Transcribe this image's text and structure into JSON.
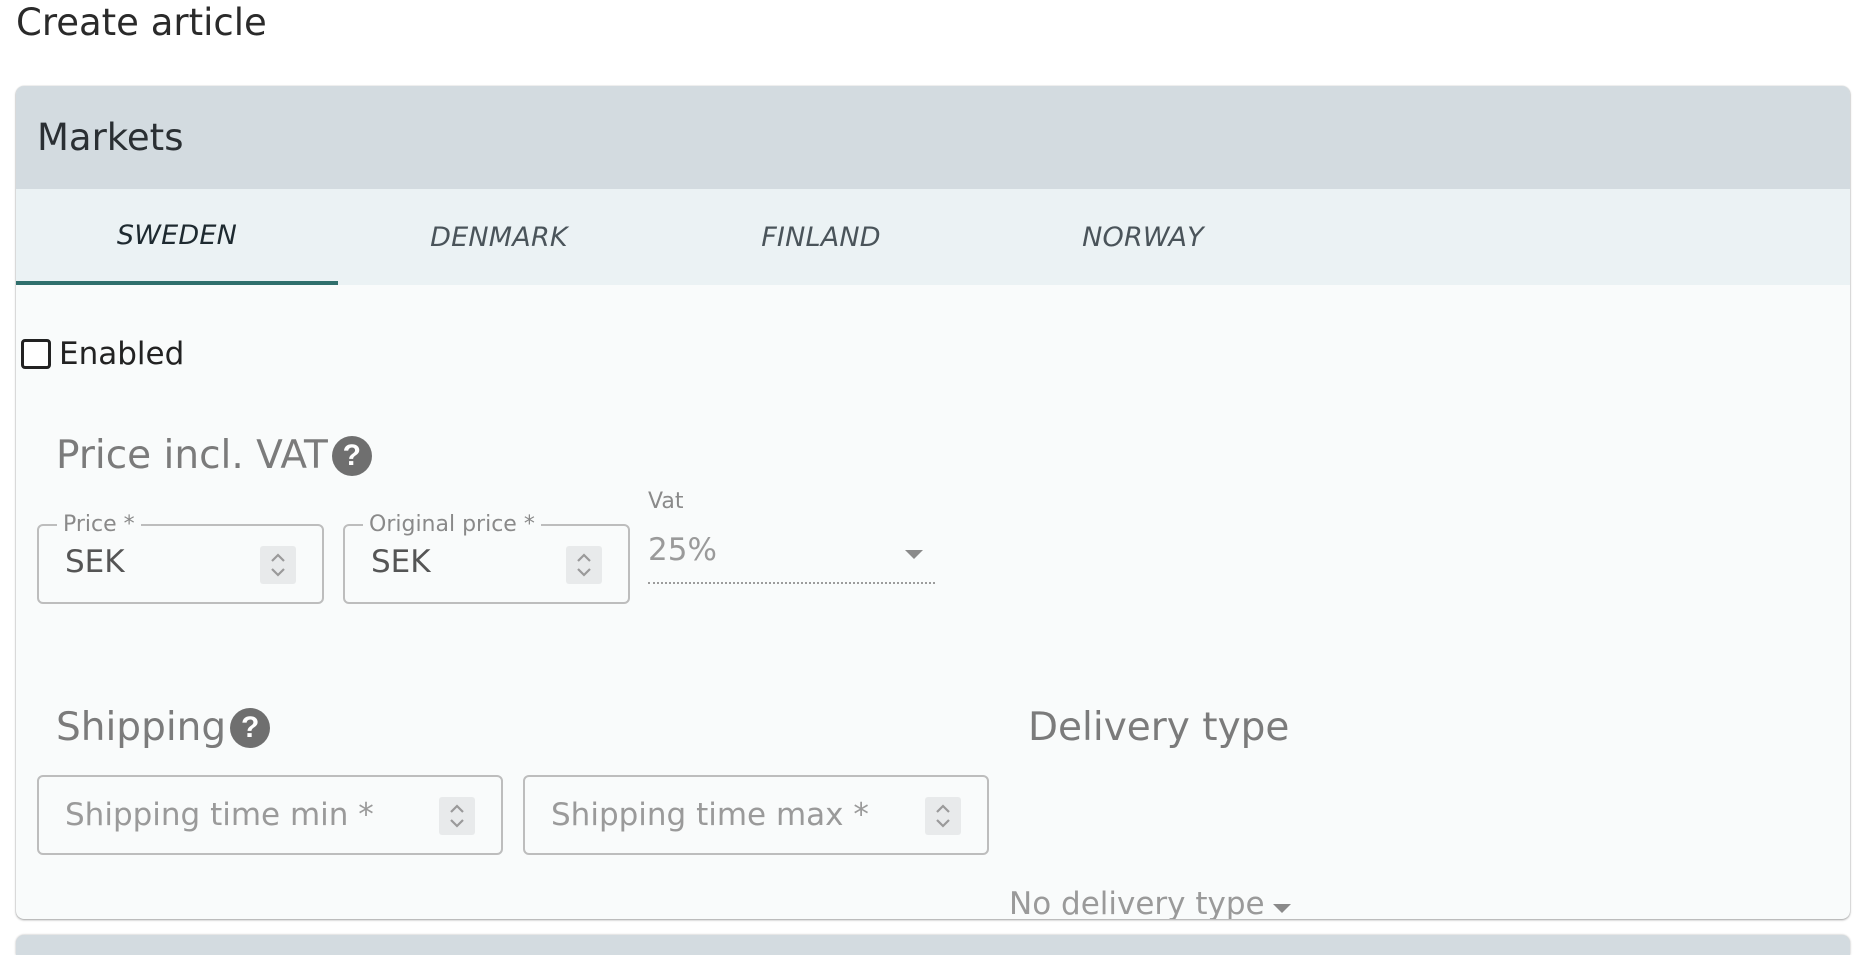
{
  "page": {
    "title": "Create article"
  },
  "markets": {
    "header": "Markets",
    "tabs": [
      {
        "label": "SWEDEN",
        "active": true
      },
      {
        "label": "DENMARK",
        "active": false
      },
      {
        "label": "FINLAND",
        "active": false
      },
      {
        "label": "NORWAY",
        "active": false
      }
    ],
    "enabled": {
      "label": "Enabled",
      "checked": false
    },
    "price_section": {
      "title": "Price incl. VAT",
      "help_icon": "question-mark-circle-icon",
      "price": {
        "label": "Price *",
        "value": "SEK"
      },
      "original_price": {
        "label": "Original price *",
        "value": "SEK"
      },
      "vat": {
        "label": "Vat",
        "value": "25%"
      }
    },
    "shipping_section": {
      "title": "Shipping",
      "help_icon": "question-mark-circle-icon",
      "min": {
        "placeholder": "Shipping time min *"
      },
      "max": {
        "placeholder": "Shipping time max *"
      }
    },
    "delivery_section": {
      "title": "Delivery type",
      "value": "No delivery type"
    }
  },
  "colors": {
    "header_bg": "#d3dbe0",
    "tabs_bg": "#ebf2f4",
    "active_tab_indicator": "#2f6f6c",
    "card_bg": "#f9fbfb"
  }
}
